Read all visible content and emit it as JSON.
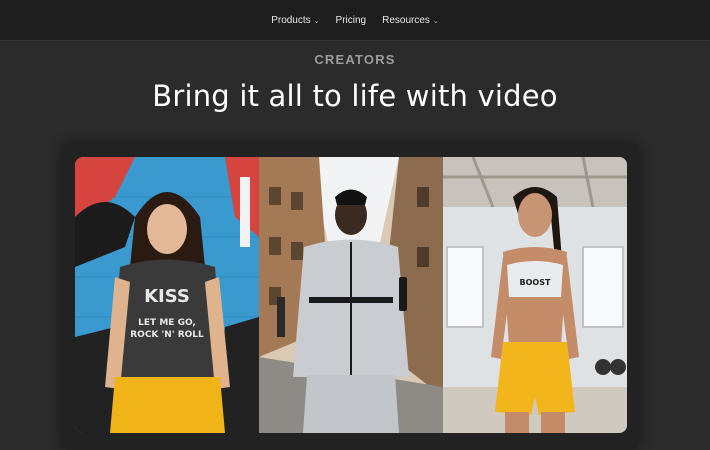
{
  "nav": {
    "items": [
      {
        "label": "Products",
        "has_dropdown": true
      },
      {
        "label": "Pricing",
        "has_dropdown": false
      },
      {
        "label": "Resources",
        "has_dropdown": true
      }
    ],
    "chevron_glyph": "⌄"
  },
  "hero": {
    "eyebrow": "CREATORS",
    "headline": "Bring it all to life with video"
  },
  "gallery": {
    "tiles": [
      {
        "subject": "woman-in-band-tshirt-by-graffiti-wall",
        "shirt_text_1": "KISS",
        "shirt_text_2": "LET ME GO,",
        "shirt_text_3": "ROCK 'N' ROLL"
      },
      {
        "subject": "man-in-grey-tracksuit-on-street"
      },
      {
        "subject": "woman-in-sports-bra-in-gym",
        "top_text": "BOOST"
      }
    ]
  },
  "colors": {
    "page_bg": "#2b2b2b",
    "nav_bg": "#1e1e1e",
    "card_bg": "#222222",
    "eyebrow": "#9c9c9c",
    "headline": "#ffffff"
  }
}
